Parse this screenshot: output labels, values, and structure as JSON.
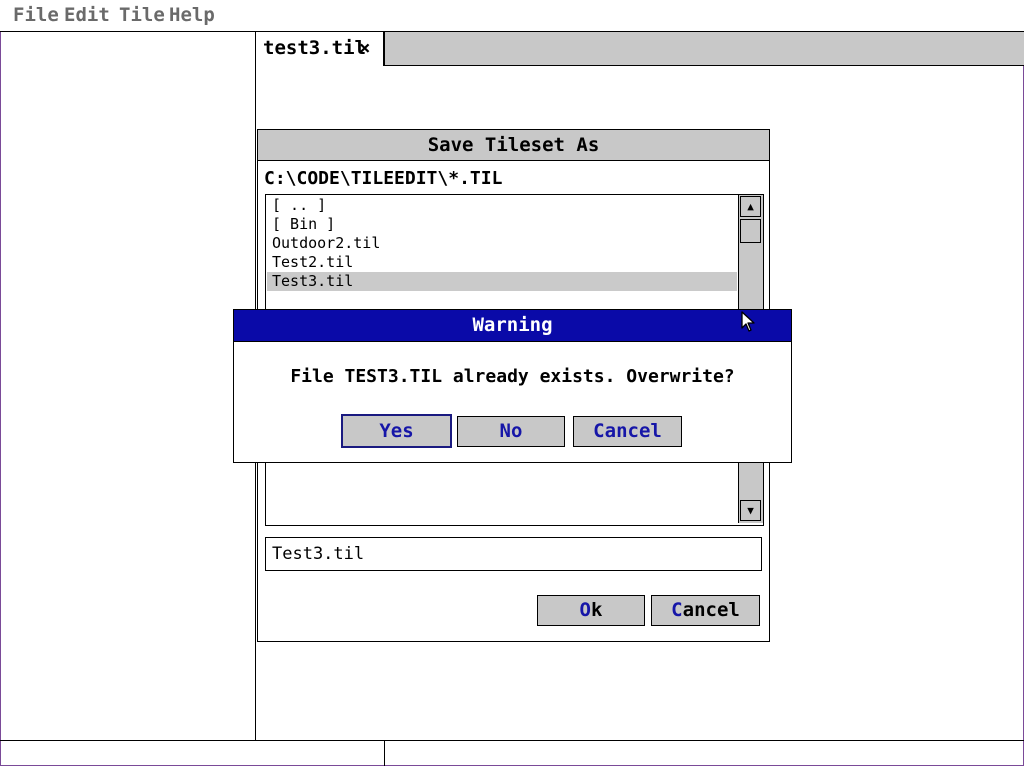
{
  "menu": {
    "items": [
      "File",
      "Edit",
      "Tile",
      "Help"
    ]
  },
  "tabs": [
    {
      "label": "test3.til",
      "close": "×"
    }
  ],
  "save_dialog": {
    "title": "Save Tileset As",
    "path": "C:\\CODE\\TILEEDIT\\*.TIL",
    "files": [
      "[ .. ]",
      "[ Bin ]",
      "Outdoor2.til",
      "Test2.til",
      "Test3.til"
    ],
    "selected_index": 4,
    "filename_value": "Test3.til",
    "ok_first": "O",
    "ok_rest": "k",
    "cancel_first": "C",
    "cancel_rest": "ancel"
  },
  "warning_dialog": {
    "title": "Warning",
    "message": "File TEST3.TIL already exists.  Overwrite?",
    "yes_first": "Y",
    "yes_rest": "es",
    "no_first": "N",
    "no_rest": "o",
    "cancel_first": "C",
    "cancel_rest": "ancel"
  },
  "colors": {
    "title_bar": "#0a0aa8",
    "hotkey": "#1616a8",
    "button_face": "#c8c8c8"
  },
  "icons": {
    "scroll_up": "▲",
    "scroll_down": "▼"
  }
}
